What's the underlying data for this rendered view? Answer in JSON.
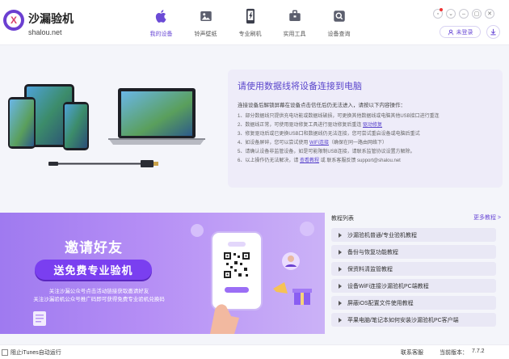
{
  "app": {
    "name": "沙漏验机",
    "domain": "shalou.net"
  },
  "nav": [
    {
      "label": "我的设备",
      "icon": "apple-icon",
      "active": true
    },
    {
      "label": "铃声壁纸",
      "icon": "image-icon",
      "active": false
    },
    {
      "label": "专业刷机",
      "icon": "phone-flash-icon",
      "active": false
    },
    {
      "label": "实用工具",
      "icon": "toolbox-icon",
      "active": false
    },
    {
      "label": "设备查询",
      "icon": "search-icon",
      "active": false
    }
  ],
  "window_controls": [
    "message-icon",
    "chevron-down-icon",
    "minimize-icon",
    "maximize-icon",
    "close-icon"
  ],
  "user": {
    "login_label": "未登录"
  },
  "connect_card": {
    "title": "请使用数据线将设备连接到电脑",
    "intro": "连接设备后解锁屏幕在设备点击信任后仍无法进入，请按以下内容操作：",
    "steps": [
      {
        "text": "1、部分数据线只提供充电功能或数据线破损，可更换其他数据线或电脑其他USB接口进行重连",
        "link": ""
      },
      {
        "text": "2、数据线正常，可使用驱动修复工具进行驱动修复后重连 ",
        "link": "驱动修复"
      },
      {
        "text": "3、修复驱动后或已更换USB口和数据线仍无法连接，您可尝试重启设备或电脑后重试",
        "link": ""
      },
      {
        "text": "4、如设备屏碎，您可以尝试使用 ",
        "link": "WiFi连接",
        "suffix": "（确保在同一路由网络下）"
      },
      {
        "text": "5、请确认设备非监管设备，如是可能限制USB连接，请联系监管协议设置方解除。",
        "link": ""
      },
      {
        "text": "6、以上操作仍无法解决，请 ",
        "link": "查看教程",
        "suffix": " 或 联系客服反馈 support@shalou.net"
      }
    ]
  },
  "banner": {
    "title": "邀请好友",
    "pill": "送免费专业验机",
    "line1": "关注沙漏公众号点击活动链接获取邀请好友",
    "line2": "关注沙漏验机公众号推广码即可获得免费专业验机兑换码",
    "accent": "#7a3ff0"
  },
  "tutorials": {
    "title": "教程列表",
    "more": "更多教程 >",
    "items": [
      "沙漏验机普通/专业验机教程",
      "备份与恢复功能教程",
      "保资料清监管教程",
      "设备WiFi连接沙漏验机PC端教程",
      "屏蔽iOS配置文件使用教程",
      "苹果电脑/笔记本如何安装沙漏验机PC客户端"
    ]
  },
  "footer": {
    "checkbox_label": "阻止iTunes自动运行",
    "contact": "联系客服",
    "version_label": "当前版本：",
    "version_value": "7.7.2"
  },
  "colors": {
    "brand": "#6b4bd6",
    "card_bg": "#eeecf9",
    "banner_start": "#9f7af0"
  }
}
